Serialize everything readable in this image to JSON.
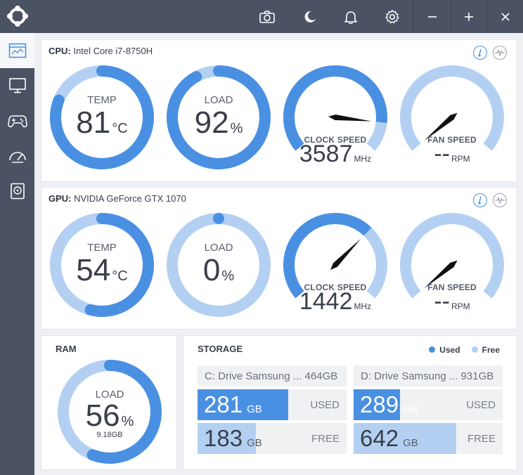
{
  "colors": {
    "accent": "#4a90e2",
    "light": "#b3d0f2",
    "titlebar": "#4a5263",
    "text": "#3a3f4a"
  },
  "titlebar": {
    "icons": [
      "camera-icon",
      "moon-icon",
      "bell-icon",
      "gear-icon",
      "minimize-icon",
      "maximize-icon",
      "close-icon"
    ]
  },
  "sidebar": {
    "items": [
      "monitor-dashboard-icon",
      "desktop-icon",
      "gamepad-icon",
      "speedometer-icon",
      "storage-drive-icon"
    ]
  },
  "cpu": {
    "label": "CPU:",
    "name": "Intel Core i7-8750H",
    "temp": {
      "label": "TEMP",
      "value": "81",
      "unit": "°C",
      "fraction": 0.81
    },
    "load": {
      "label": "LOAD",
      "value": "92",
      "unit": "%",
      "fraction": 0.92
    },
    "clock": {
      "label": "CLOCK SPEED",
      "value": "3587",
      "unit": "MHz",
      "fraction": 0.87
    },
    "fan": {
      "label": "FAN SPEED",
      "value": "--",
      "unit": "RPM",
      "fraction": 0.0
    }
  },
  "gpu": {
    "label": "GPU:",
    "name": "NVIDIA GeForce GTX 1070",
    "temp": {
      "label": "TEMP",
      "value": "54",
      "unit": "°C",
      "fraction": 0.54
    },
    "load": {
      "label": "LOAD",
      "value": "0",
      "unit": "%",
      "fraction": 0.0
    },
    "clock": {
      "label": "CLOCK SPEED",
      "value": "1442",
      "unit": "MHz",
      "fraction": 0.67
    },
    "fan": {
      "label": "FAN SPEED",
      "value": "--",
      "unit": "RPM",
      "fraction": 0.0
    }
  },
  "ram": {
    "title": "RAM",
    "label": "LOAD",
    "value": "56",
    "unit": "%",
    "sub": "9.18GB",
    "fraction": 0.56
  },
  "storage": {
    "title": "STORAGE",
    "legend": {
      "used": "Used",
      "free": "Free"
    },
    "drives": [
      {
        "name": "C: Drive Samsung ... 464GB",
        "used": "281",
        "free": "183",
        "gb": "GB",
        "used_label": "USED",
        "free_label": "FREE",
        "used_fraction": 0.61,
        "free_fraction": 0.39
      },
      {
        "name": "D: Drive Samsung ... 931GB",
        "used": "289",
        "free": "642",
        "gb": "GB",
        "used_label": "USED",
        "free_label": "FREE",
        "used_fraction": 0.31,
        "free_fraction": 0.69
      }
    ]
  }
}
